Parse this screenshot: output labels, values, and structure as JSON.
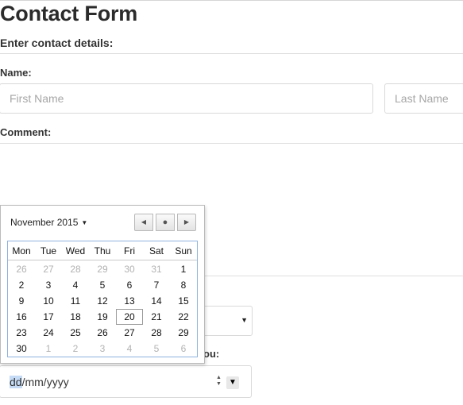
{
  "form": {
    "title": "Contact Form",
    "subtitle": "Enter contact details:",
    "name_label": "Name:",
    "first_name_placeholder": "First Name",
    "last_name_placeholder": "Last Name",
    "comment_label": "Comment:",
    "date_label_partial": "ou:",
    "date_input": {
      "day": "dd",
      "month": "mm",
      "year": "yyyy",
      "separator": "/"
    }
  },
  "calendar": {
    "month_label": "November 2015",
    "weekdays": [
      "Mon",
      "Tue",
      "Wed",
      "Thu",
      "Fri",
      "Sat",
      "Sun"
    ],
    "weeks": [
      [
        {
          "d": "26",
          "m": true
        },
        {
          "d": "27",
          "m": true
        },
        {
          "d": "28",
          "m": true
        },
        {
          "d": "29",
          "m": true
        },
        {
          "d": "30",
          "m": true
        },
        {
          "d": "31",
          "m": true
        },
        {
          "d": "1",
          "m": false
        }
      ],
      [
        {
          "d": "2",
          "m": false
        },
        {
          "d": "3",
          "m": false
        },
        {
          "d": "4",
          "m": false
        },
        {
          "d": "5",
          "m": false
        },
        {
          "d": "6",
          "m": false
        },
        {
          "d": "7",
          "m": false
        },
        {
          "d": "8",
          "m": false
        }
      ],
      [
        {
          "d": "9",
          "m": false
        },
        {
          "d": "10",
          "m": false
        },
        {
          "d": "11",
          "m": false
        },
        {
          "d": "12",
          "m": false
        },
        {
          "d": "13",
          "m": false
        },
        {
          "d": "14",
          "m": false
        },
        {
          "d": "15",
          "m": false
        }
      ],
      [
        {
          "d": "16",
          "m": false
        },
        {
          "d": "17",
          "m": false
        },
        {
          "d": "18",
          "m": false
        },
        {
          "d": "19",
          "m": false
        },
        {
          "d": "20",
          "m": false,
          "sel": true
        },
        {
          "d": "21",
          "m": false
        },
        {
          "d": "22",
          "m": false
        }
      ],
      [
        {
          "d": "23",
          "m": false
        },
        {
          "d": "24",
          "m": false
        },
        {
          "d": "25",
          "m": false
        },
        {
          "d": "26",
          "m": false
        },
        {
          "d": "27",
          "m": false
        },
        {
          "d": "28",
          "m": false
        },
        {
          "d": "29",
          "m": false
        }
      ],
      [
        {
          "d": "30",
          "m": false
        },
        {
          "d": "1",
          "m": true
        },
        {
          "d": "2",
          "m": true
        },
        {
          "d": "3",
          "m": true
        },
        {
          "d": "4",
          "m": true
        },
        {
          "d": "5",
          "m": true
        },
        {
          "d": "6",
          "m": true
        }
      ]
    ]
  },
  "icons": {
    "prev": "triangle-left-icon",
    "today": "dot-icon",
    "next": "triangle-right-icon",
    "month_caret": "caret-down-icon",
    "select_arrow": "caret-down-icon"
  }
}
